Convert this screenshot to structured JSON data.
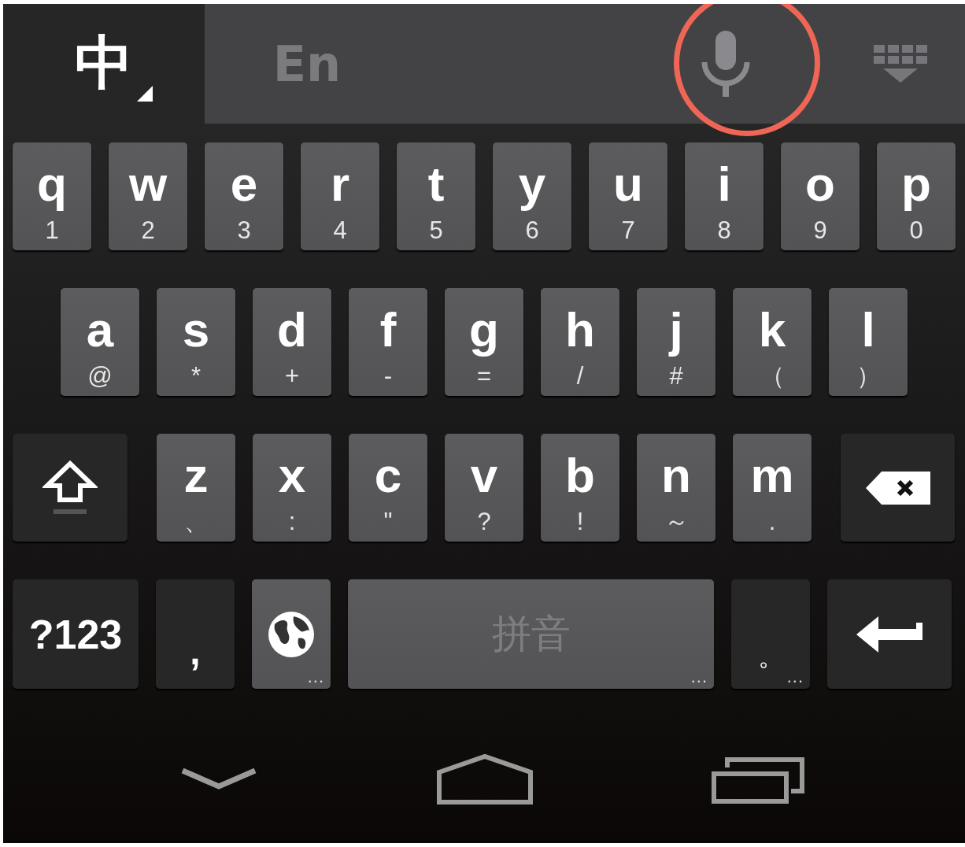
{
  "tabs": [
    {
      "label": "中",
      "selected": true
    },
    {
      "label": "En",
      "selected": false
    }
  ],
  "rows": [
    [
      {
        "kind": "letter",
        "label": "q",
        "secondary": "1"
      },
      {
        "kind": "letter",
        "label": "w",
        "secondary": "2"
      },
      {
        "kind": "letter",
        "label": "e",
        "secondary": "3"
      },
      {
        "kind": "letter",
        "label": "r",
        "secondary": "4"
      },
      {
        "kind": "letter",
        "label": "t",
        "secondary": "5"
      },
      {
        "kind": "letter",
        "label": "y",
        "secondary": "6"
      },
      {
        "kind": "letter",
        "label": "u",
        "secondary": "7"
      },
      {
        "kind": "letter",
        "label": "i",
        "secondary": "8"
      },
      {
        "kind": "letter",
        "label": "o",
        "secondary": "9"
      },
      {
        "kind": "letter",
        "label": "p",
        "secondary": "0"
      }
    ],
    [
      {
        "kind": "letter",
        "label": "a",
        "secondary": "@"
      },
      {
        "kind": "letter",
        "label": "s",
        "secondary": "*"
      },
      {
        "kind": "letter",
        "label": "d",
        "secondary": "+"
      },
      {
        "kind": "letter",
        "label": "f",
        "secondary": "-"
      },
      {
        "kind": "letter",
        "label": "g",
        "secondary": "="
      },
      {
        "kind": "letter",
        "label": "h",
        "secondary": "/"
      },
      {
        "kind": "letter",
        "label": "j",
        "secondary": "#"
      },
      {
        "kind": "letter",
        "label": "k",
        "secondary": "（"
      },
      {
        "kind": "letter",
        "label": "l",
        "secondary": "）"
      }
    ],
    [
      {
        "kind": "shift"
      },
      {
        "kind": "letter",
        "label": "z",
        "secondary": "、"
      },
      {
        "kind": "letter",
        "label": "x",
        "secondary": ":"
      },
      {
        "kind": "letter",
        "label": "c",
        "secondary": "\""
      },
      {
        "kind": "letter",
        "label": "v",
        "secondary": "?"
      },
      {
        "kind": "letter",
        "label": "b",
        "secondary": "!"
      },
      {
        "kind": "letter",
        "label": "n",
        "secondary": "～"
      },
      {
        "kind": "letter",
        "label": "m",
        "secondary": "."
      },
      {
        "kind": "backspace"
      }
    ],
    [
      {
        "kind": "symbols",
        "label": "?123"
      },
      {
        "kind": "comma",
        "label": ","
      },
      {
        "kind": "globe",
        "more": "..."
      },
      {
        "kind": "space",
        "label": "拼音",
        "more": "..."
      },
      {
        "kind": "period",
        "label": "。",
        "more": "..."
      },
      {
        "kind": "enter"
      }
    ]
  ]
}
